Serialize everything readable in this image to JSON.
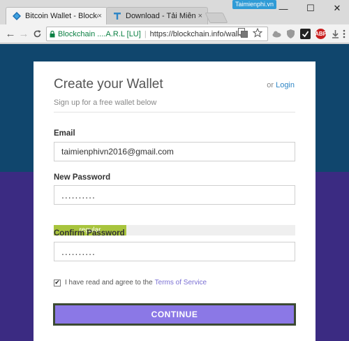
{
  "browser": {
    "tabs": [
      {
        "title": "Bitcoin Wallet - Blockcha",
        "close": "×",
        "icon": "blockchain-diamond-icon"
      },
      {
        "title": "Download - Tải Miễn Phí",
        "close": "×",
        "icon": "t-letter-icon"
      }
    ],
    "watermark": "Taimienphi.vn",
    "window_controls": {
      "minimize": "—",
      "maximize": "☐",
      "close": "✕"
    },
    "nav": {
      "back": "←",
      "forward": "→",
      "reload": "C"
    },
    "address": {
      "lock": "🔒",
      "secure_label": "Blockchain ....A.R.L [LU]",
      "separator": "|",
      "url": "https://blockchain.info/wallet"
    },
    "extensions": [
      "translate-icon",
      "star-icon",
      "cloud-icon",
      "shield-icon",
      "checkmark-extension-icon",
      "abp-icon",
      "download-icon",
      "menu-icon"
    ],
    "abp_label": "ABP"
  },
  "form": {
    "title": "Create your Wallet",
    "or_text": "or",
    "login_link": "Login",
    "subtitle": "Sign up for a free wallet below",
    "email_label": "Email",
    "email_value": "taimienphivn2016@gmail.com",
    "new_password_label": "New Password",
    "new_password_value": "..........",
    "strength_label": "regular",
    "strength_level": 0.3,
    "confirm_password_label": "Confirm Password",
    "confirm_password_value": "..........",
    "agree_checked": true,
    "agree_text": "I have read and agree to the",
    "terms_link": "Terms of Service",
    "continue_label": "CONTINUE"
  },
  "colors": {
    "page_top": "#10466d",
    "page_bottom": "#3b2b82",
    "link": "#2f86c6",
    "strength": "#a8c43d",
    "continue_button": "#8b78e6"
  }
}
